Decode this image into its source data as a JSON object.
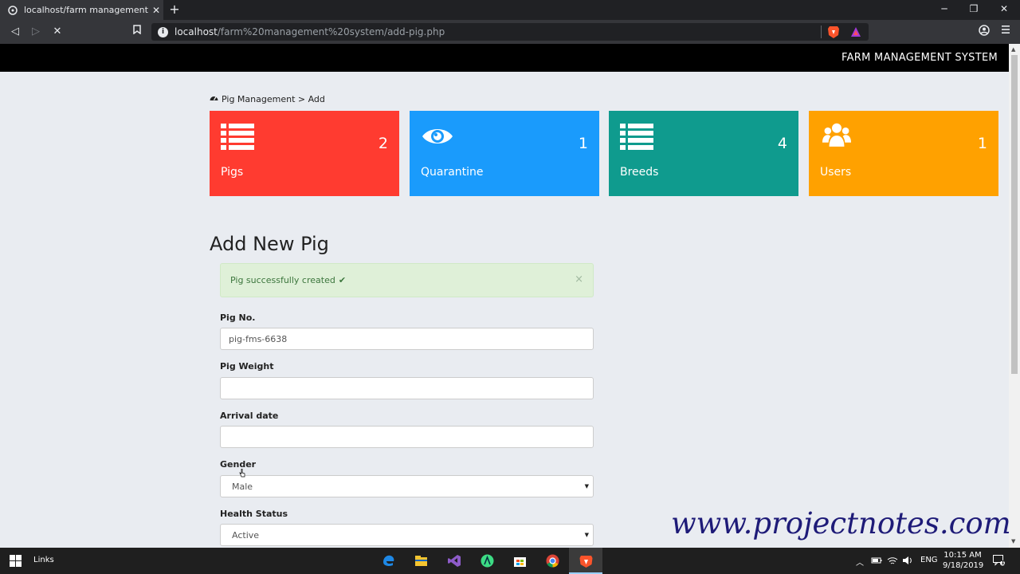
{
  "browser": {
    "tab_title": "localhost/farm management syste",
    "tab_close": "✕",
    "new_tab": "+",
    "window_min": "─",
    "window_restore": "❐",
    "window_close": "✕",
    "url_host": "localhost",
    "url_path": "/farm%20management%20system/add-pig.php",
    "back": "◁",
    "forward": "▷",
    "stop": "✕",
    "bookmark": "🔖"
  },
  "navbar": {
    "brand": "FARM MANAGEMENT SYSTEM"
  },
  "breadcrumb": {
    "text": "Pig Management > Add"
  },
  "cards": [
    {
      "label": "Pigs",
      "count": "2",
      "color": "#ff3b30",
      "icon": "list-icon"
    },
    {
      "label": "Quarantine",
      "count": "1",
      "color": "#1a9bfc",
      "icon": "eye-icon"
    },
    {
      "label": "Breeds",
      "count": "4",
      "color": "#0f9b8e",
      "icon": "list-icon"
    },
    {
      "label": "Users",
      "count": "1",
      "color": "#ffa100",
      "icon": "users-icon"
    }
  ],
  "form": {
    "title": "Add New Pig",
    "alert": {
      "message": "Pig successfully created",
      "check": "✔",
      "dismiss": "×"
    },
    "pig_no": {
      "label": "Pig No.",
      "value": "pig-fms-6638"
    },
    "pig_weight": {
      "label": "Pig Weight",
      "value": ""
    },
    "arrival_date": {
      "label": "Arrival date",
      "value": ""
    },
    "gender": {
      "label": "Gender",
      "value": "Male"
    },
    "health_status": {
      "label": "Health Status",
      "value": "Active"
    }
  },
  "watermark": "www.projectnotes.com",
  "taskbar": {
    "links_label": "Links",
    "lang": "ENG",
    "time": "10:15 AM",
    "date": "9/18/2019",
    "notification_count": "1"
  }
}
